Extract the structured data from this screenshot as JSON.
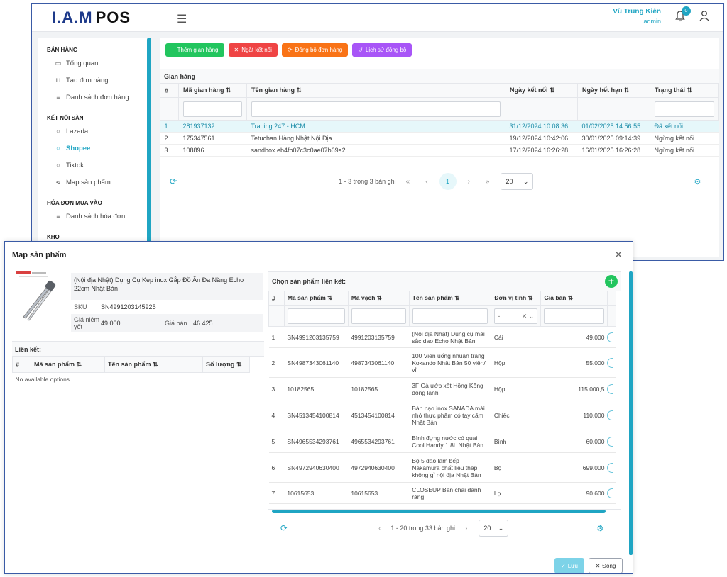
{
  "app": {
    "logo_main": "I.A.M",
    "logo_sub": "POS",
    "user_name": "Vũ Trung Kiên",
    "user_role": "admin",
    "notification_count": "0"
  },
  "sidebar": {
    "sections": [
      {
        "title": "BÁN HÀNG",
        "items": [
          {
            "label": "Tổng quan",
            "icon": "monitor-icon"
          },
          {
            "label": "Tạo đơn hàng",
            "icon": "cart-icon"
          },
          {
            "label": "Danh sách đơn hàng",
            "icon": "list-icon"
          }
        ]
      },
      {
        "title": "KẾT NỐI SÀN",
        "items": [
          {
            "label": "Lazada",
            "icon": "circle-icon"
          },
          {
            "label": "Shopee",
            "icon": "circle-icon",
            "active": true
          },
          {
            "label": "Tiktok",
            "icon": "circle-icon"
          },
          {
            "label": "Map sản phẩm",
            "icon": "share-icon"
          }
        ]
      },
      {
        "title": "HÓA ĐƠN MUA VÀO",
        "items": [
          {
            "label": "Danh sách hóa đơn",
            "icon": "list-icon"
          }
        ]
      },
      {
        "title": "KHO",
        "items": []
      }
    ]
  },
  "toolbar": {
    "add_store": "Thêm gian hàng",
    "disconnect": "Ngắt kết nối",
    "sync_orders": "Đồng bộ đơn hàng",
    "sync_history": "Lịch sử đồng bộ"
  },
  "stores": {
    "caption": "Gian hàng",
    "columns": [
      "#",
      "Mã gian hàng",
      "Tên gian hàng",
      "Ngày kết nối",
      "Ngày hết hạn",
      "Trạng thái"
    ],
    "rows": [
      [
        "1",
        "281937132",
        "Trading 247 - HCM",
        "31/12/2024 10:08:36",
        "01/02/2025 14:56:55",
        "Đã kết nối"
      ],
      [
        "2",
        "175347561",
        "Tetuchan Hàng Nhật Nội Địa",
        "19/12/2024 10:42:06",
        "30/01/2025 09:14:39",
        "Ngừng kết nối"
      ],
      [
        "3",
        "108896",
        "sandbox.eb4fb07c3c0ae07b69a2",
        "17/12/2024 16:26:28",
        "16/01/2025 16:26:28",
        "Ngừng kết nối"
      ]
    ],
    "pager_text": "1 - 3 trong 3 bản ghi",
    "current_page": "1",
    "page_size": "20"
  },
  "modal": {
    "title": "Map sản phẩm",
    "product": {
      "name": "(Nội địa Nhật) Dụng Cụ Kẹp inox Gắp Đồ Ăn Đa Năng Echo 22cm Nhật Bản",
      "sku_label": "SKU",
      "sku": "SN4991203145925",
      "list_price_label": "Giá niêm yết",
      "list_price": "49.000",
      "sale_price_label": "Giá bán",
      "sale_price": "46.425"
    },
    "linked": {
      "title": "Liên kết:",
      "columns": [
        "#",
        "Mã sản phẩm",
        "Tên sản phẩm",
        "Số lượng"
      ],
      "empty": "No available options"
    },
    "picker": {
      "title": "Chọn sản phẩm liên kết:",
      "columns": [
        "#",
        "Mã sản phẩm",
        "Mã vạch",
        "Tên sản phẩm",
        "Đơn vị tính",
        "Giá bán"
      ],
      "unit_filter": "-",
      "rows": [
        [
          "1",
          "SN4991203135759",
          "4991203135759",
          "(Nội địa Nhật) Dụng cụ mài sắc dao Echo Nhật Bản",
          "Cái",
          "49.000"
        ],
        [
          "2",
          "SN4987343061140",
          "4987343061140",
          "100 Viên uống nhuận tràng Kokando Nhật Bản 50 viên/ vỉ",
          "Hộp",
          "55.000"
        ],
        [
          "3",
          "10182565",
          "10182565",
          "3F Gà ướp xốt Hồng Kông đông lạnh",
          "Hộp",
          "115.000,5"
        ],
        [
          "4",
          "SN4513454100814",
          "4513454100814",
          "Bàn nạo inox SANADA mài nhỏ thực phẩm có tay cầm Nhật Bản",
          "Chiếc",
          "110.000"
        ],
        [
          "5",
          "SN4965534293761",
          "4965534293761",
          "Bình đựng nước có quai Cool Handy 1.8L Nhật Bản",
          "Bình",
          "60.000"
        ],
        [
          "6",
          "SN4972940630400",
          "4972940630400",
          "Bộ 5 dao làm bếp Nakamura chất liệu thép không gỉ nội địa Nhật Bản",
          "Bộ",
          "699.000"
        ],
        [
          "7",
          "10615653",
          "10615653",
          "CLOSEUP Bàn chải đánh răng",
          "Lọ",
          "90.600"
        ]
      ],
      "pager_text": "1 - 20 trong 33 bản ghi",
      "page_size": "20"
    },
    "save_label": "Lưu",
    "close_label": "Đóng"
  }
}
